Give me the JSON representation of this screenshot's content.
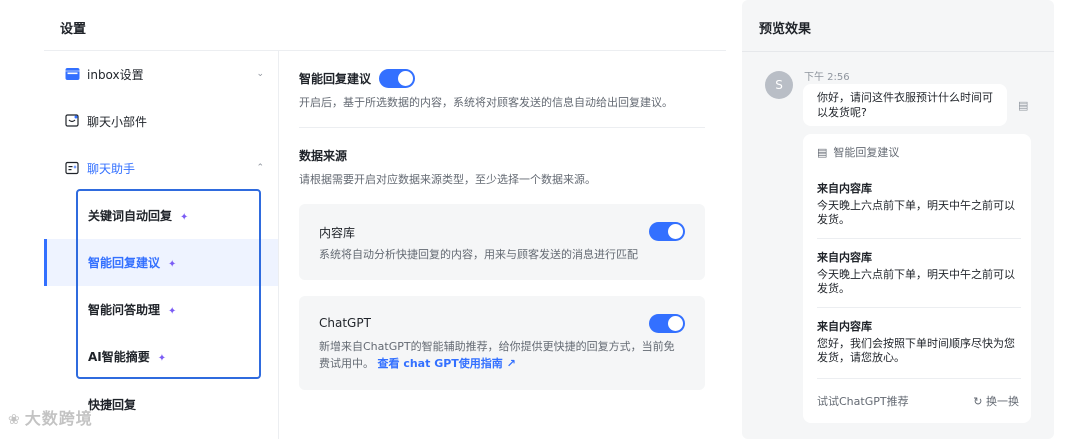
{
  "page": {
    "title": "设置"
  },
  "sidebar": {
    "items": [
      {
        "label": "inbox设置",
        "icon": "inbox-icon"
      },
      {
        "label": "聊天小部件",
        "icon": "chat-widget-icon"
      },
      {
        "label": "聊天助手",
        "icon": "assistant-icon"
      }
    ],
    "sub_items": [
      {
        "label": "关键词自动回复"
      },
      {
        "label": "智能回复建议"
      },
      {
        "label": "智能问答助理"
      },
      {
        "label": "AI智能摘要"
      },
      {
        "label": "快捷回复"
      }
    ],
    "accent_color": "#3370ff"
  },
  "main": {
    "smart_reply": {
      "title": "智能回复建议",
      "desc": "开启后，基于所选数据的内容，系统将对顾客发送的信息自动给出回复建议。",
      "enabled": true
    },
    "data_source": {
      "title": "数据来源",
      "desc": "请根据需要开启对应数据来源类型，至少选择一个数据来源。"
    },
    "content_lib": {
      "title": "内容库",
      "desc": "系统将自动分析快捷回复的内容，用来与顾客发送的消息进行匹配",
      "enabled": true
    },
    "chatgpt": {
      "title": "ChatGPT",
      "desc": "新增来自ChatGPT的智能辅助推荐，给你提供更快捷的回复方式，当前免费试用中。",
      "link": "查看 chat GPT使用指南",
      "enabled": true
    }
  },
  "preview": {
    "title": "预览效果",
    "avatar_letter": "S",
    "time": "下午 2:56",
    "message": "你好，请问这件衣服预计什么时间可以发货呢?",
    "suggestion_header": "智能回复建议",
    "suggestions": [
      {
        "source": "来自内容库",
        "text": "今天晚上六点前下单，明天中午之前可以发货。"
      },
      {
        "source": "来自内容库",
        "text": "今天晚上六点前下单，明天中午之前可以发货。"
      },
      {
        "source": "来自内容库",
        "text": "您好，我们会按照下单时间顺序尽快为您发货，请您放心。"
      }
    ],
    "try_chatgpt": "试试ChatGPT推荐",
    "refresh": "换一换"
  },
  "watermark": {
    "text": "大数跨境"
  }
}
